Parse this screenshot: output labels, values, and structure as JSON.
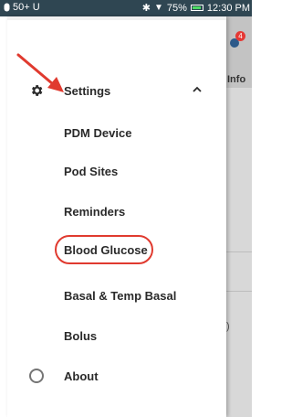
{
  "status_bar": {
    "left_text": "50+ U",
    "battery": "75%",
    "time": "12:30 PM",
    "icons": [
      "bluetooth-icon",
      "wifi-icon",
      "battery-icon"
    ]
  },
  "background_app": {
    "header_label": "Info",
    "badge_count": "4",
    "partial_text": ")"
  },
  "drawer": {
    "settings": {
      "label": "Settings",
      "icon": "gear-icon",
      "expanded": true
    },
    "submenu": [
      {
        "label": "PDM Device"
      },
      {
        "label": "Pod Sites"
      },
      {
        "label": "Reminders"
      },
      {
        "label": "Blood Glucose",
        "highlighted": true
      },
      {
        "label": "Basal & Temp Basal"
      },
      {
        "label": "Bolus"
      }
    ],
    "about": {
      "label": "About",
      "icon": "info-circle-icon"
    }
  },
  "annotation": {
    "color": "#e03a2f"
  }
}
